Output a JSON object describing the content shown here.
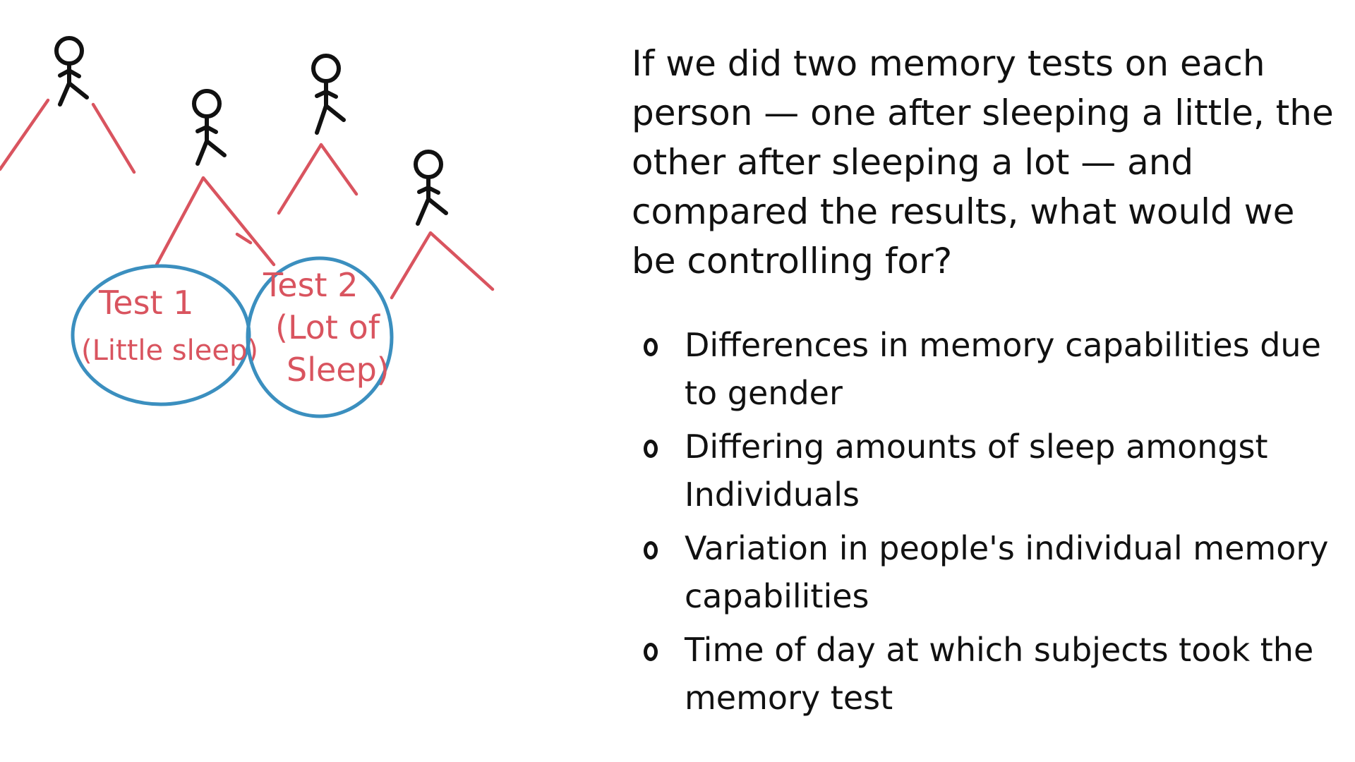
{
  "question": "If we did two memory tests on each person — one after sleeping a little, the other after sleeping a lot — and compared the results, what would we be controlling for?",
  "options": [
    "Differences in memory capabilities due to gender",
    "Differing amounts of sleep amongst Individuals",
    "Variation in people's individual memory capabilities",
    "Time of day at which subjects took the memory test"
  ],
  "tests": {
    "test1_title": "Test 1",
    "test1_note": "(Little sleep)",
    "test2_title": "Test 2",
    "test2_note_line1": "(Lot of",
    "test2_note_line2": "Sleep)"
  },
  "colors": {
    "ink": "#111111",
    "sketch_red": "#d9545f",
    "circle_blue": "#3b8fbf"
  }
}
